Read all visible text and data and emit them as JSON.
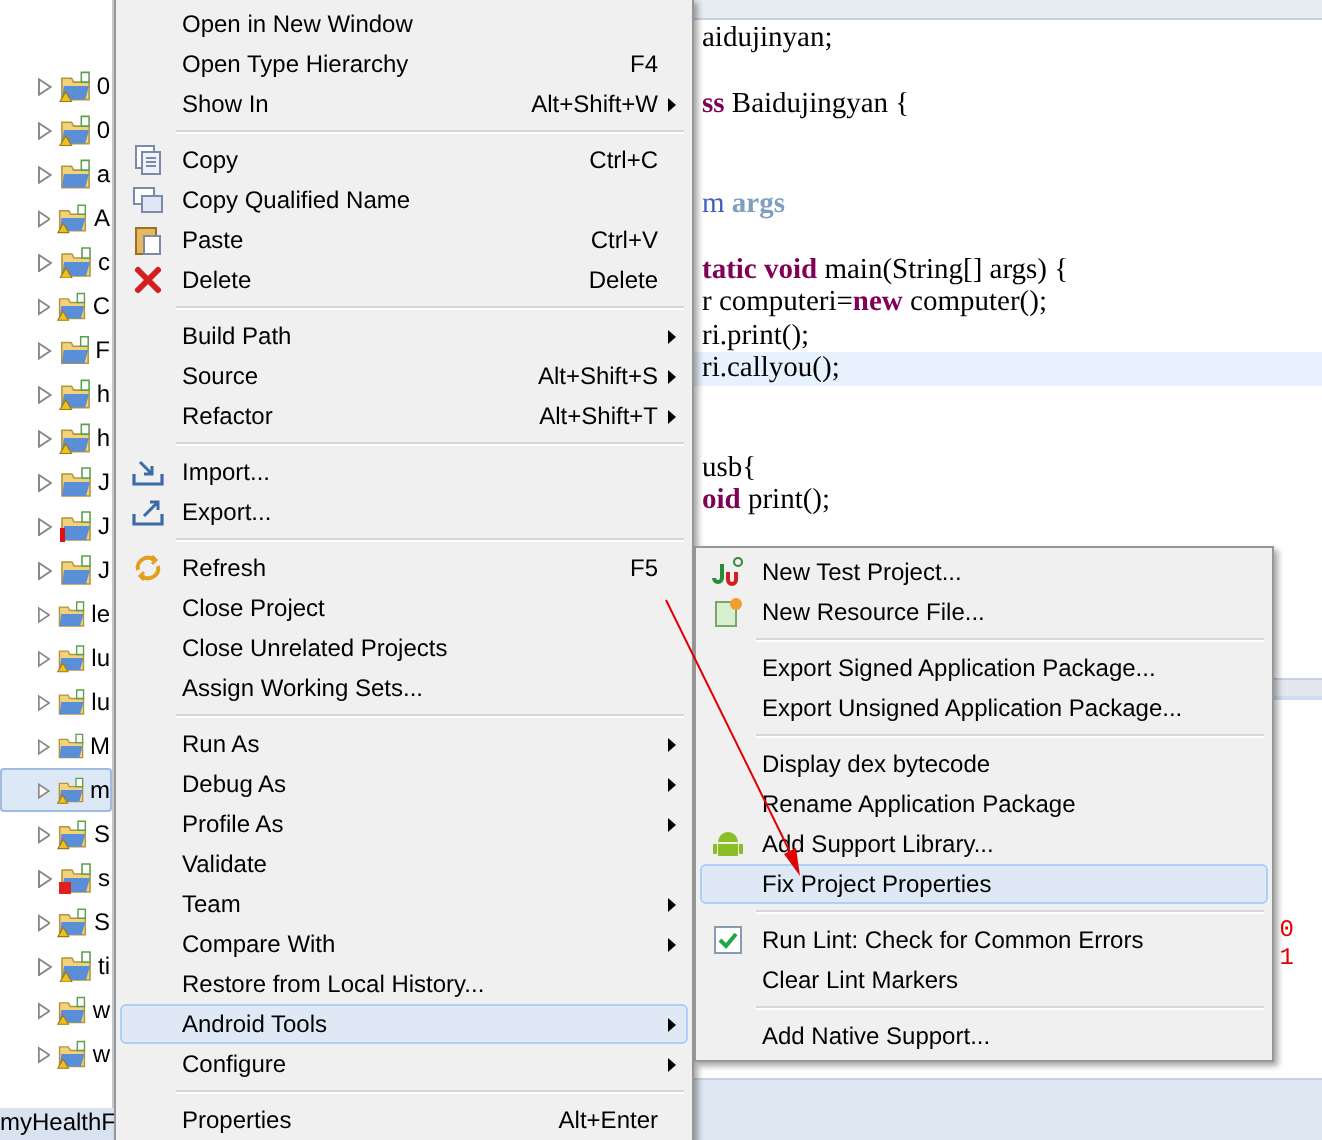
{
  "project_tree": {
    "items": [
      {
        "label": "0",
        "kind": "warning",
        "selected": false
      },
      {
        "label": "0",
        "kind": "warning",
        "selected": false
      },
      {
        "label": "a",
        "kind": "plain",
        "selected": false
      },
      {
        "label": "A",
        "kind": "warning",
        "selected": false
      },
      {
        "label": "c",
        "kind": "warning",
        "selected": false
      },
      {
        "label": "C",
        "kind": "warning",
        "selected": false
      },
      {
        "label": "F",
        "kind": "plain",
        "selected": false
      },
      {
        "label": "h",
        "kind": "warning",
        "selected": false
      },
      {
        "label": "h",
        "kind": "warning",
        "selected": false
      },
      {
        "label": "J",
        "kind": "plain",
        "selected": false
      },
      {
        "label": "J",
        "kind": "error",
        "selected": false
      },
      {
        "label": "J",
        "kind": "plain",
        "selected": false
      },
      {
        "label": "le",
        "kind": "plain",
        "selected": false
      },
      {
        "label": "lu",
        "kind": "warning",
        "selected": false
      },
      {
        "label": "lu",
        "kind": "plain",
        "selected": false
      },
      {
        "label": "M",
        "kind": "plain",
        "selected": false
      },
      {
        "label": "m",
        "kind": "warning",
        "selected": true
      },
      {
        "label": "S",
        "kind": "warning",
        "selected": false
      },
      {
        "label": "s",
        "kind": "broken",
        "selected": false
      },
      {
        "label": "S",
        "kind": "warning",
        "selected": false
      },
      {
        "label": "ti",
        "kind": "warning",
        "selected": false
      },
      {
        "label": "w",
        "kind": "warning",
        "selected": false
      },
      {
        "label": "w",
        "kind": "warning",
        "selected": false
      }
    ]
  },
  "status_bar": {
    "text": "myHealthF"
  },
  "editor": {
    "lines": [
      {
        "kind": "code",
        "highlighted": false,
        "segments": [
          {
            "text": "aidujinyan;",
            "kind": "plain"
          }
        ]
      },
      {
        "kind": "blank"
      },
      {
        "kind": "code",
        "highlighted": false,
        "segments": [
          {
            "text": "ss",
            "kind": "keyword"
          },
          {
            "text": " Baidujingyan {",
            "kind": "plain"
          }
        ]
      },
      {
        "kind": "blank"
      },
      {
        "kind": "blank"
      },
      {
        "kind": "code",
        "highlighted": false,
        "segments": [
          {
            "text": "m",
            "kind": "doc"
          },
          {
            "text": " args",
            "kind": "doctag"
          }
        ]
      },
      {
        "kind": "blank"
      },
      {
        "kind": "code",
        "highlighted": false,
        "segments": [
          {
            "text": "tatic void",
            "kind": "keyword"
          },
          {
            "text": " main(String[] args) {",
            "kind": "plain"
          }
        ]
      },
      {
        "kind": "code",
        "highlighted": false,
        "segments": [
          {
            "text": "r computeri=",
            "kind": "plain"
          },
          {
            "text": "new",
            "kind": "keyword"
          },
          {
            "text": " computer();",
            "kind": "plain"
          }
        ]
      },
      {
        "kind": "code",
        "highlighted": false,
        "segments": [
          {
            "text": "ri.print();",
            "kind": "plain"
          }
        ]
      },
      {
        "kind": "code",
        "highlighted": true,
        "segments": [
          {
            "text": "ri.callyou();",
            "kind": "plain"
          }
        ]
      },
      {
        "kind": "blank"
      },
      {
        "kind": "blank"
      },
      {
        "kind": "code",
        "highlighted": false,
        "segments": [
          {
            "text": "usb{",
            "kind": "plain"
          }
        ]
      },
      {
        "kind": "code",
        "highlighted": false,
        "segments": [
          {
            "text": "oid",
            "kind": "keyword"
          },
          {
            "text": " print();",
            "kind": "plain"
          }
        ]
      }
    ],
    "console_lines": [
      "0",
      "1"
    ]
  },
  "context_menu": {
    "groups": [
      [
        {
          "label": "Open in New Window",
          "kind": "none",
          "selected": false,
          "submenu": false
        },
        {
          "label": "Open Type Hierarchy",
          "shortcut": "F4",
          "kind": "none",
          "selected": false,
          "submenu": false
        },
        {
          "label": "Show In",
          "shortcut": "Alt+Shift+W",
          "kind": "none",
          "selected": false,
          "submenu": true
        }
      ],
      [
        {
          "label": "Copy",
          "shortcut": "Ctrl+C",
          "kind": "copy",
          "selected": false,
          "submenu": false
        },
        {
          "label": "Copy Qualified Name",
          "kind": "copy-name",
          "selected": false,
          "submenu": false
        },
        {
          "label": "Paste",
          "shortcut": "Ctrl+V",
          "kind": "paste",
          "selected": false,
          "submenu": false
        },
        {
          "label": "Delete",
          "shortcut": "Delete",
          "kind": "delete",
          "selected": false,
          "submenu": false
        }
      ],
      [
        {
          "label": "Build Path",
          "kind": "none",
          "selected": false,
          "submenu": true
        },
        {
          "label": "Source",
          "shortcut": "Alt+Shift+S",
          "kind": "none",
          "selected": false,
          "submenu": true
        },
        {
          "label": "Refactor",
          "shortcut": "Alt+Shift+T",
          "kind": "none",
          "selected": false,
          "submenu": true
        }
      ],
      [
        {
          "label": "Import...",
          "kind": "import",
          "selected": false,
          "submenu": false
        },
        {
          "label": "Export...",
          "kind": "export",
          "selected": false,
          "submenu": false
        }
      ],
      [
        {
          "label": "Refresh",
          "shortcut": "F5",
          "kind": "refresh",
          "selected": false,
          "submenu": false
        },
        {
          "label": "Close Project",
          "kind": "none",
          "selected": false,
          "submenu": false
        },
        {
          "label": "Close Unrelated Projects",
          "kind": "none",
          "selected": false,
          "submenu": false
        },
        {
          "label": "Assign Working Sets...",
          "kind": "none",
          "selected": false,
          "submenu": false
        }
      ],
      [
        {
          "label": "Run As",
          "kind": "none",
          "selected": false,
          "submenu": true
        },
        {
          "label": "Debug As",
          "kind": "none",
          "selected": false,
          "submenu": true
        },
        {
          "label": "Profile As",
          "kind": "none",
          "selected": false,
          "submenu": true
        },
        {
          "label": "Validate",
          "kind": "none",
          "selected": false,
          "submenu": false
        },
        {
          "label": "Team",
          "kind": "none",
          "selected": false,
          "submenu": true
        },
        {
          "label": "Compare With",
          "kind": "none",
          "selected": false,
          "submenu": true
        },
        {
          "label": "Restore from Local History...",
          "kind": "none",
          "selected": false,
          "submenu": false
        },
        {
          "label": "Android Tools",
          "kind": "none",
          "selected": true,
          "submenu": true
        },
        {
          "label": "Configure",
          "kind": "none",
          "selected": false,
          "submenu": true
        }
      ],
      [
        {
          "label": "Properties",
          "shortcut": "Alt+Enter",
          "kind": "none",
          "selected": false,
          "submenu": false
        }
      ]
    ]
  },
  "submenu": {
    "groups": [
      [
        {
          "label": "New Test Project...",
          "kind": "junit",
          "selected": false
        },
        {
          "label": "New Resource File...",
          "kind": "resource",
          "selected": false
        }
      ],
      [
        {
          "label": "Export Signed Application Package...",
          "kind": "none",
          "selected": false
        },
        {
          "label": "Export Unsigned Application Package...",
          "kind": "none",
          "selected": false
        }
      ],
      [
        {
          "label": "Display dex bytecode",
          "kind": "none",
          "selected": false
        },
        {
          "label": "Rename Application Package",
          "kind": "none",
          "selected": false
        },
        {
          "label": "Add Support Library...",
          "kind": "android",
          "selected": false
        },
        {
          "label": "Fix Project Properties",
          "kind": "none",
          "selected": true
        }
      ],
      [
        {
          "label": "Run Lint: Check for Common Errors",
          "kind": "check",
          "selected": false
        },
        {
          "label": "Clear Lint Markers",
          "kind": "none",
          "selected": false
        }
      ],
      [
        {
          "label": "Add Native Support...",
          "kind": "none",
          "selected": false
        }
      ]
    ]
  }
}
